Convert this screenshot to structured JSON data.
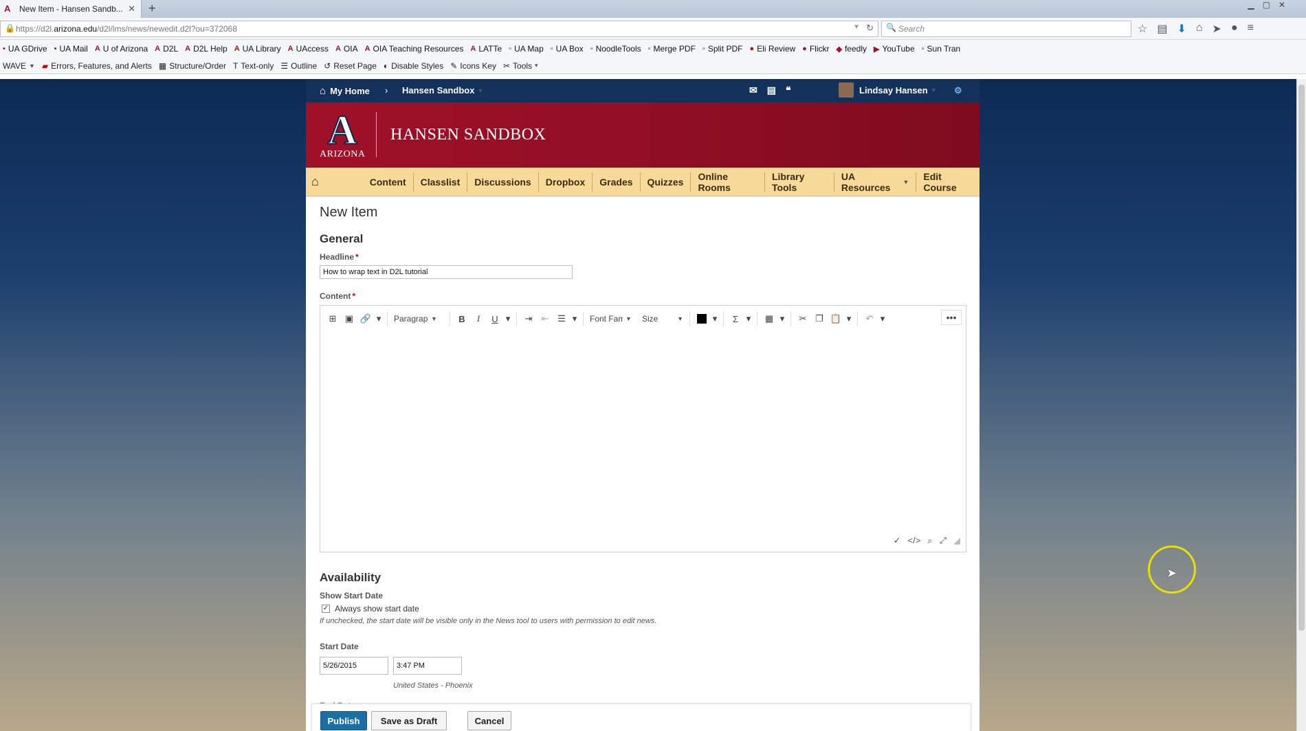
{
  "browser": {
    "tab_title": "New Item - Hansen Sandb...",
    "url_prefix": "https://d2l.",
    "url_host": "arizona.edu",
    "url_path": "/d2l/lms/news/newedit.d2l?ou=372068",
    "search_placeholder": "Search",
    "bookmarks": [
      "UA GDrive",
      "UA Mail",
      "U of Arizona",
      "D2L",
      "D2L Help",
      "UA Library",
      "UAccess",
      "OIA",
      "OIA Teaching Resources",
      "LATTe",
      "UA Map",
      "UA Box",
      "NoodleTools",
      "Merge PDF",
      "Split PDF",
      "Eli Review",
      "Flickr",
      "feedly",
      "YouTube",
      "Sun Tran"
    ],
    "wave_toolbar": [
      "WAVE",
      "Errors, Features, and Alerts",
      "Structure/Order",
      "Text-only",
      "Outline",
      "Reset Page",
      "Disable Styles",
      "Icons Key",
      "Tools"
    ]
  },
  "minibar": {
    "home": "My Home",
    "course": "Hansen Sandbox",
    "user": "Lindsay Hansen"
  },
  "banner": {
    "logo_word": "ARIZONA",
    "course_title": "HANSEN SANDBOX"
  },
  "course_nav": [
    "Content",
    "Classlist",
    "Discussions",
    "Dropbox",
    "Grades",
    "Quizzes",
    "Online Rooms",
    "Library Tools",
    "UA Resources",
    "Edit Course"
  ],
  "form": {
    "page_title": "New Item",
    "general_title": "General",
    "headline_label": "Headline",
    "headline_value": "How to wrap text in D2L tutorial",
    "content_label": "Content",
    "editor": {
      "paragraph": "Paragraph",
      "font_family": "Font Family",
      "size": "Size"
    },
    "availability_title": "Availability",
    "show_start_label": "Show Start Date",
    "always_show_label": "Always show start date",
    "always_show_checked": true,
    "always_show_hint": "If unchecked, the start date will be visible only in the News tool to users with permission to edit news.",
    "start_date_label": "Start Date",
    "start_date": "5/26/2015",
    "start_time": "3:47 PM",
    "timezone": "United States - Phoenix",
    "end_date_label": "End Date"
  },
  "buttons": {
    "publish": "Publish",
    "save_draft": "Save as Draft",
    "cancel": "Cancel"
  }
}
